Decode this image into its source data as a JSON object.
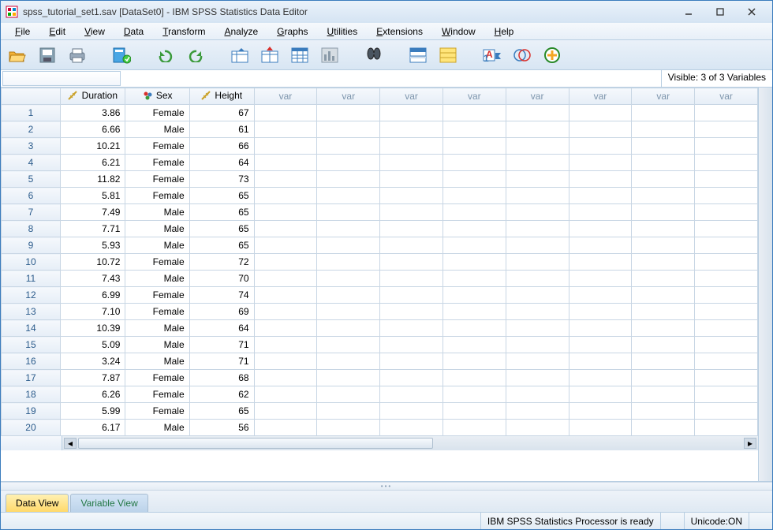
{
  "window": {
    "title": "spss_tutorial_set1.sav [DataSet0] - IBM SPSS Statistics Data Editor"
  },
  "menu": [
    "File",
    "Edit",
    "View",
    "Data",
    "Transform",
    "Analyze",
    "Graphs",
    "Utilities",
    "Extensions",
    "Window",
    "Help"
  ],
  "info": {
    "visible": "Visible: 3 of 3 Variables"
  },
  "columns": {
    "named": [
      "Duration",
      "Sex",
      "Height"
    ],
    "placeholder": "var",
    "placeholder_count": 8
  },
  "rows": [
    {
      "n": 1,
      "duration": "3.86",
      "sex": "Female",
      "height": "67"
    },
    {
      "n": 2,
      "duration": "6.66",
      "sex": "Male",
      "height": "61"
    },
    {
      "n": 3,
      "duration": "10.21",
      "sex": "Female",
      "height": "66"
    },
    {
      "n": 4,
      "duration": "6.21",
      "sex": "Female",
      "height": "64"
    },
    {
      "n": 5,
      "duration": "11.82",
      "sex": "Female",
      "height": "73"
    },
    {
      "n": 6,
      "duration": "5.81",
      "sex": "Female",
      "height": "65"
    },
    {
      "n": 7,
      "duration": "7.49",
      "sex": "Male",
      "height": "65"
    },
    {
      "n": 8,
      "duration": "7.71",
      "sex": "Male",
      "height": "65"
    },
    {
      "n": 9,
      "duration": "5.93",
      "sex": "Male",
      "height": "65"
    },
    {
      "n": 10,
      "duration": "10.72",
      "sex": "Female",
      "height": "72"
    },
    {
      "n": 11,
      "duration": "7.43",
      "sex": "Male",
      "height": "70"
    },
    {
      "n": 12,
      "duration": "6.99",
      "sex": "Female",
      "height": "74"
    },
    {
      "n": 13,
      "duration": "7.10",
      "sex": "Female",
      "height": "69"
    },
    {
      "n": 14,
      "duration": "10.39",
      "sex": "Male",
      "height": "64"
    },
    {
      "n": 15,
      "duration": "5.09",
      "sex": "Male",
      "height": "71"
    },
    {
      "n": 16,
      "duration": "3.24",
      "sex": "Male",
      "height": "71"
    },
    {
      "n": 17,
      "duration": "7.87",
      "sex": "Female",
      "height": "68"
    },
    {
      "n": 18,
      "duration": "6.26",
      "sex": "Female",
      "height": "62"
    },
    {
      "n": 19,
      "duration": "5.99",
      "sex": "Female",
      "height": "65"
    },
    {
      "n": 20,
      "duration": "6.17",
      "sex": "Male",
      "height": "56"
    }
  ],
  "tabs": {
    "data": "Data View",
    "variable": "Variable View"
  },
  "status": {
    "processor": "IBM SPSS Statistics Processor is ready",
    "unicode": "Unicode:ON"
  }
}
